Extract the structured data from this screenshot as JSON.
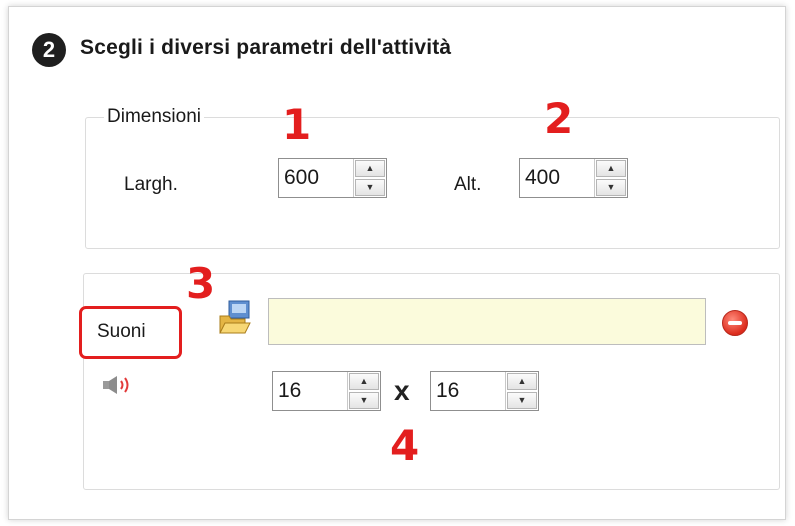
{
  "step": {
    "number": "2",
    "title": "Scegli i diversi parametri dell'attività"
  },
  "dimensions": {
    "legend": "Dimensioni",
    "width_label": "Largh.",
    "width_value": "600",
    "height_label": "Alt.",
    "height_value": "400"
  },
  "sounds": {
    "label": "Suoni",
    "file_value": "",
    "size_width": "16",
    "size_height": "16",
    "separator": "x"
  },
  "icons": {
    "step_badge": "circled-number-icon",
    "folder": "folder-open-icon",
    "remove": "remove-icon",
    "speaker": "speaker-icon",
    "spin_up": "spin-up-arrow-icon",
    "spin_down": "spin-down-arrow-icon"
  },
  "annotations": {
    "marker_1": "1",
    "marker_2": "2",
    "marker_3": "3",
    "marker_4": "4",
    "color": "#e31e1e"
  },
  "colors": {
    "file_input_bg": "#fbfbdc",
    "remove_icon": "#dc2b1c"
  }
}
